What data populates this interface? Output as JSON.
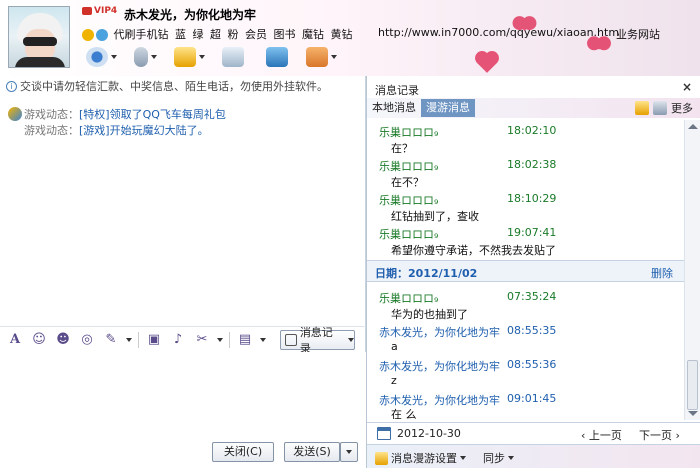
{
  "header": {
    "vip_label": "VIP4",
    "nickname": "赤木发光，为你化地为牢",
    "links": [
      "代刷手机钻",
      "蓝",
      "绿",
      "超",
      "粉",
      "会员",
      "图书",
      "魔钻",
      "黄钻"
    ],
    "url": "http://www.in7000.com/qqyewu/xiaoan.htm",
    "business": "业务网站",
    "toolbar_icons": [
      "video-call-icon",
      "voice-call-icon",
      "file-transfer-icon",
      "multi-chat-icon",
      "remote-assist-icon",
      "apps-icon"
    ]
  },
  "left": {
    "notice": "交谈中请勿轻信汇款、中奖信息、陌生电话，勿使用外挂软件。",
    "game_messages": [
      {
        "label": "游戏动态：",
        "text": "[特权]领取了QQ飞车每周礼包"
      },
      {
        "label": "游戏动态：",
        "text": "[游戏]开始玩魔幻大陆了。"
      }
    ],
    "format_icons": [
      "font-icon",
      "emoji-icon",
      "magic-face-icon",
      "shake-icon",
      "screenshot-icon",
      "image-icon",
      "music-icon",
      "scissors-icon",
      "more-icon"
    ],
    "msg_log_button": "消息记录",
    "close_button": "关闭(C)",
    "send_button": "发送(S)"
  },
  "right": {
    "title": "消息记录",
    "close": "×",
    "tabs": [
      "本地消息",
      "漫游消息"
    ],
    "more": "更多",
    "messages_before": [
      {
        "sender": "乐巢ロロロ₉",
        "time": "18:02:10",
        "text": "在？",
        "me": false
      },
      {
        "sender": "乐巢ロロロ₉",
        "time": "18:02:38",
        "text": "在不？",
        "me": false
      },
      {
        "sender": "乐巢ロロロ₉",
        "time": "18:10:29",
        "text": "红钻抽到了，查收",
        "me": false
      },
      {
        "sender": "乐巢ロロロ₉",
        "time": "19:07:41",
        "text": "希望你遵守承诺，不然我去发贴了",
        "me": false
      }
    ],
    "date_bar": {
      "label": "日期：2012/11/02",
      "delete": "删除"
    },
    "messages_after": [
      {
        "sender": "乐巢ロロロ₉",
        "time": "07:35:24",
        "text": "华为的也抽到了",
        "me": false
      },
      {
        "sender": "赤木发光，为你化地为牢",
        "time": "08:55:35",
        "text": "a",
        "me": true
      },
      {
        "sender": "赤木发光，为你化地为牢",
        "time": "08:55:36",
        "text": "z",
        "me": true
      },
      {
        "sender": "赤木发光，为你化地为牢",
        "time": "09:01:45",
        "text": "在 么",
        "me": true
      }
    ],
    "nav": {
      "date": "2012-10-30",
      "prev": "上一页",
      "next": "下一页"
    },
    "footer": {
      "roam_settings": "消息漫游设置",
      "sync": "同步"
    }
  }
}
